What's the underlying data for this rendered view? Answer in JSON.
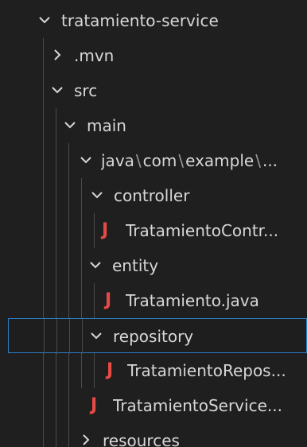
{
  "explorer": {
    "items": [
      {
        "label": "tratamiento-service",
        "expanded": true,
        "type": "folder"
      },
      {
        "label": ".mvn",
        "expanded": false,
        "type": "folder"
      },
      {
        "label": "src",
        "expanded": true,
        "type": "folder"
      },
      {
        "label": "main",
        "expanded": true,
        "type": "folder"
      },
      {
        "label_parts": [
          "java",
          "com",
          "example",
          "..."
        ],
        "expanded": true,
        "type": "folder"
      },
      {
        "label": "controller",
        "expanded": true,
        "type": "folder"
      },
      {
        "label": "TratamientoContr...",
        "type": "java-file"
      },
      {
        "label": "entity",
        "expanded": true,
        "type": "folder"
      },
      {
        "label": "Tratamiento.java",
        "type": "java-file"
      },
      {
        "label": "repository",
        "expanded": true,
        "type": "folder",
        "selected": true
      },
      {
        "label": "TratamientoRepos...",
        "type": "java-file"
      },
      {
        "label": "TratamientoService...",
        "type": "java-file"
      },
      {
        "label": "resources",
        "expanded": false,
        "type": "folder"
      }
    ],
    "java_icon_glyph": "J",
    "java_icon_color": "#e64a45",
    "selection_border_color": "#2b7fc8",
    "background_color": "#1f1f1f",
    "text_color": "#d7d7d7",
    "icons": {
      "expanded": "chevron-down-icon",
      "collapsed": "chevron-right-icon",
      "java": "java-file-icon"
    }
  }
}
